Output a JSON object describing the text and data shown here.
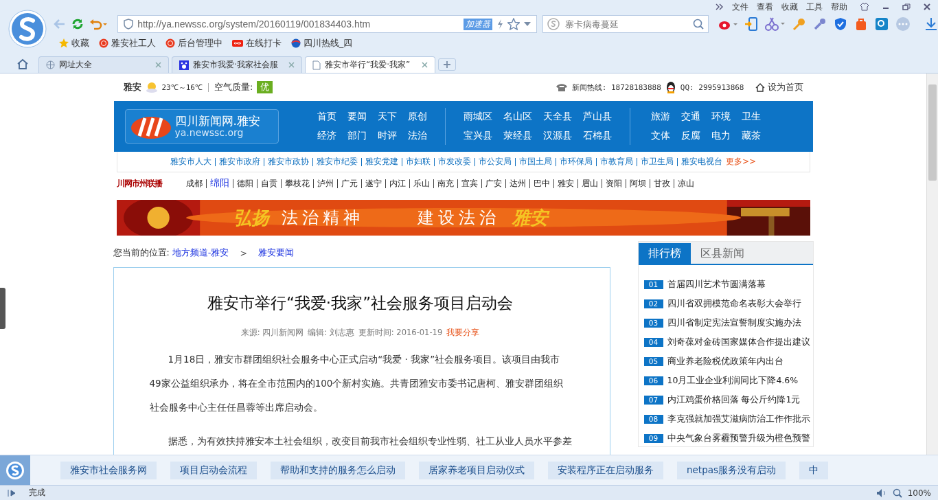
{
  "browser": {
    "menu": [
      "文件",
      "查看",
      "收藏",
      "工具",
      "帮助"
    ],
    "address": {
      "url": "http://ya.newssc.org/system/20160119/001834403.htm",
      "accelerator": "加速器"
    },
    "search": {
      "placeholder": "寨卡病毒蔓延"
    },
    "bookmarks": [
      "收藏",
      "雅安社工人",
      "后台管理中",
      "在线打卡",
      "四川热线_四"
    ],
    "tabs": [
      {
        "label": "网址大全",
        "selected": false
      },
      {
        "label": "雅安市我爱·我家社会服",
        "selected": false
      },
      {
        "label": "雅安市举行“我爱·我家”",
        "selected": true
      }
    ]
  },
  "topbar": {
    "city": "雅安",
    "temp": "23℃～16℃",
    "air_label": "空气质量:",
    "air_value": "优",
    "hotline": "新闻热线: 18728183888",
    "qq": "QQ: 2995913868",
    "set_home": "设为首页"
  },
  "logo": {
    "name": "四川新闻网.雅安",
    "domain": "ya.newssc.org"
  },
  "nav_groups": [
    [
      "首页",
      "要闻",
      "天下",
      "原创",
      "经济",
      "部门",
      "时评",
      "法治"
    ],
    [
      "雨城区",
      "名山区",
      "天全县",
      "芦山县",
      "宝兴县",
      "荥经县",
      "汉源县",
      "石棉县"
    ],
    [
      "旅游",
      "交通",
      "环境",
      "卫生",
      "文体",
      "反腐",
      "电力",
      "藏茶"
    ]
  ],
  "dept_links": [
    "雅安市人大",
    "雅安市政府",
    "雅安市政协",
    "雅安市纪委",
    "雅安党建",
    "市妇联",
    "市发改委",
    "市公安局",
    "市国土局",
    "市环保局",
    "市教育局",
    "市卫生局",
    "雅安电视台"
  ],
  "dept_more": "更多>>",
  "city_bar": {
    "label": "川网市州联播",
    "cities": [
      {
        "name": "成都",
        "selected": false
      },
      {
        "name": "绵阳",
        "selected": true
      },
      {
        "name": "德阳",
        "selected": false
      },
      {
        "name": "自贡",
        "selected": false
      },
      {
        "name": "攀枝花",
        "selected": false
      },
      {
        "name": "泸州",
        "selected": false
      },
      {
        "name": "广元",
        "selected": false
      },
      {
        "name": "遂宁",
        "selected": false
      },
      {
        "name": "内江",
        "selected": false
      },
      {
        "name": "乐山",
        "selected": false
      },
      {
        "name": "南充",
        "selected": false
      },
      {
        "name": "宜宾",
        "selected": false
      },
      {
        "name": "广安",
        "selected": false
      },
      {
        "name": "达州",
        "selected": false
      },
      {
        "name": "巴中",
        "selected": false
      },
      {
        "name": "雅安",
        "selected": false
      },
      {
        "name": "眉山",
        "selected": false
      },
      {
        "name": "资阳",
        "selected": false
      },
      {
        "name": "阿坝",
        "selected": false
      },
      {
        "name": "甘孜",
        "selected": false
      },
      {
        "name": "凉山",
        "selected": false
      }
    ]
  },
  "banner": [
    "弘扬",
    "法治精神",
    "建设法治",
    "雅安"
  ],
  "breadcrumb": {
    "label": "您当前的位置:",
    "links": [
      "地方频道-雅安",
      "雅安要闻"
    ],
    "separator": ">"
  },
  "article": {
    "title": "雅安市举行“我爱·我家”社会服务项目启动会",
    "source": "来源: 四川新闻网",
    "editor": "编辑: 刘志惠",
    "time": "更新时间: 2016-01-19",
    "share": "我要分享",
    "paragraphs": [
      "1月18日，雅安市群团组织社会服务中心正式启动“我爱 · 我家”社会服务项目。该项目由我市49家公益组织承办，将在全市范围内的100个新村实施。共青团雅安市委书记唐柯、雅安群团组织社会服务中心主任任昌蓉等出席启动会。",
      "据悉，为有效扶持雅安本土社会组织，改变目前我市社会组织专业性弱、社工从业人员水平参差"
    ]
  },
  "sidebar": {
    "tabs": [
      {
        "label": "排行榜",
        "selected": true
      },
      {
        "label": "区县新闻",
        "selected": false
      }
    ],
    "items": [
      {
        "num": "01",
        "text": "首届四川艺术节圆满落幕"
      },
      {
        "num": "02",
        "text": "四川省双拥模范命名表彰大会举行"
      },
      {
        "num": "03",
        "text": "四川省制定宪法宣誓制度实施办法"
      },
      {
        "num": "04",
        "text": "刘奇葆对金砖国家媒体合作提出建议"
      },
      {
        "num": "05",
        "text": "商业养老险税优政策年内出台"
      },
      {
        "num": "06",
        "text": "10月工业企业利润同比下降4.6%"
      },
      {
        "num": "07",
        "text": "内江鸡蛋价格回落 每公斤约降1元"
      },
      {
        "num": "08",
        "text": "李克强就加强艾滋病防治工作作批示"
      },
      {
        "num": "09",
        "text": "中央气象台雾霾预警升级为橙色预警"
      }
    ]
  },
  "suggestions": [
    "雅安市社会服务网",
    "项目启动会流程",
    "帮助和支持的服务怎么启动",
    "居家养老项目启动仪式",
    "安装程序正在启动服务",
    "netpas服务没有启动",
    "中"
  ],
  "status": {
    "text": "完成",
    "zoom": "100%"
  }
}
